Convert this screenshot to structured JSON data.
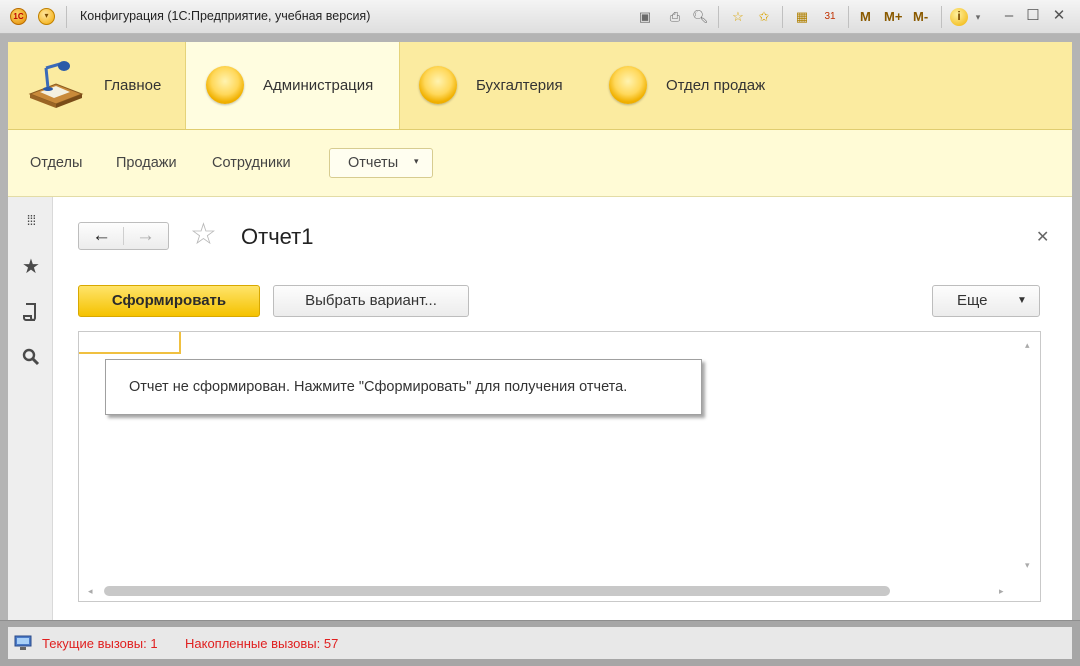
{
  "window": {
    "logo_text": "1С",
    "title": "Конфигурация  (1С:Предприятие, учебная версия)",
    "toolbar_text": [
      "M",
      "M+",
      "M-"
    ]
  },
  "sections": [
    {
      "label": "Главное",
      "icon": "desk-lamp-icon"
    },
    {
      "label": "Администрация",
      "icon": "section-circle-icon",
      "active": true
    },
    {
      "label": "Бухгалтерия",
      "icon": "section-circle-icon"
    },
    {
      "label": "Отдел продаж",
      "icon": "section-circle-icon"
    }
  ],
  "nav": {
    "items": [
      "Отделы",
      "Продажи",
      "Сотрудники"
    ],
    "reports_label": "Отчеты"
  },
  "form": {
    "title": "Отчет1",
    "generate_label": "Сформировать",
    "variant_label": "Выбрать вариант...",
    "more_label": "Еще",
    "message": "Отчет не сформирован. Нажмите \"Сформировать\" для получения отчета."
  },
  "status": {
    "current_calls": "Текущие вызовы: 1",
    "accumulated_calls": "Накопленные вызовы: 57"
  },
  "colors": {
    "sections_bg": "#fbeba0",
    "nav_bg": "#fffbd6",
    "primary_button": "#f5c200",
    "status_text": "#e02020"
  }
}
